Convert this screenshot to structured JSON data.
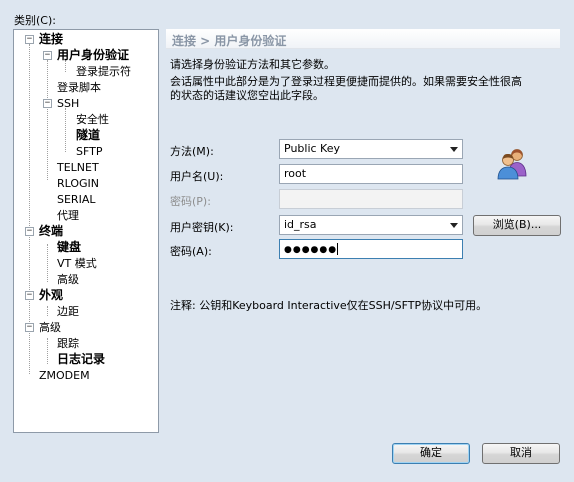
{
  "category_label": "类别(C):",
  "tree": {
    "connection": "连接",
    "authentication": "用户身份验证",
    "login_prompts": "登录提示符",
    "login_script": "登录脚本",
    "ssh": "SSH",
    "security": "安全性",
    "tunneling": "隧道",
    "sftp": "SFTP",
    "telnet": "TELNET",
    "rlogin": "RLOGIN",
    "serial": "SERIAL",
    "proxy": "代理",
    "terminal": "终端",
    "keyboard": "键盘",
    "vt_mode": "VT 模式",
    "terminal_advanced": "高级",
    "appearance": "外观",
    "margin": "边距",
    "advanced": "高级",
    "trace": "跟踪",
    "logging": "日志记录",
    "zmodem": "ZMODEM",
    "expander_minus": "−"
  },
  "section_header": "连接 > 用户身份验证",
  "description": {
    "line1": "请选择身份验证方法和其它参数。",
    "line2": "会话属性中此部分是为了登录过程更便捷而提供的。如果需要安全性很高",
    "line3": "的状态的话建议您空出此字段。"
  },
  "form": {
    "method_label": "方法(M):",
    "method_value": "Public Key",
    "username_label": "用户名(U):",
    "username_value": "root",
    "password_label": "密码(P):",
    "password_value": "",
    "user_key_label": "用户密钥(K):",
    "user_key_value": "id_rsa",
    "browse_label": "浏览(B)...",
    "passphrase_label": "密码(A):",
    "passphrase_value": "●●●●●●"
  },
  "note": "注释: 公钥和Keyboard Interactive仅在SSH/SFTP协议中可用。",
  "buttons": {
    "ok": "确定",
    "cancel": "取消"
  },
  "icons": {
    "users": "users-icon"
  }
}
